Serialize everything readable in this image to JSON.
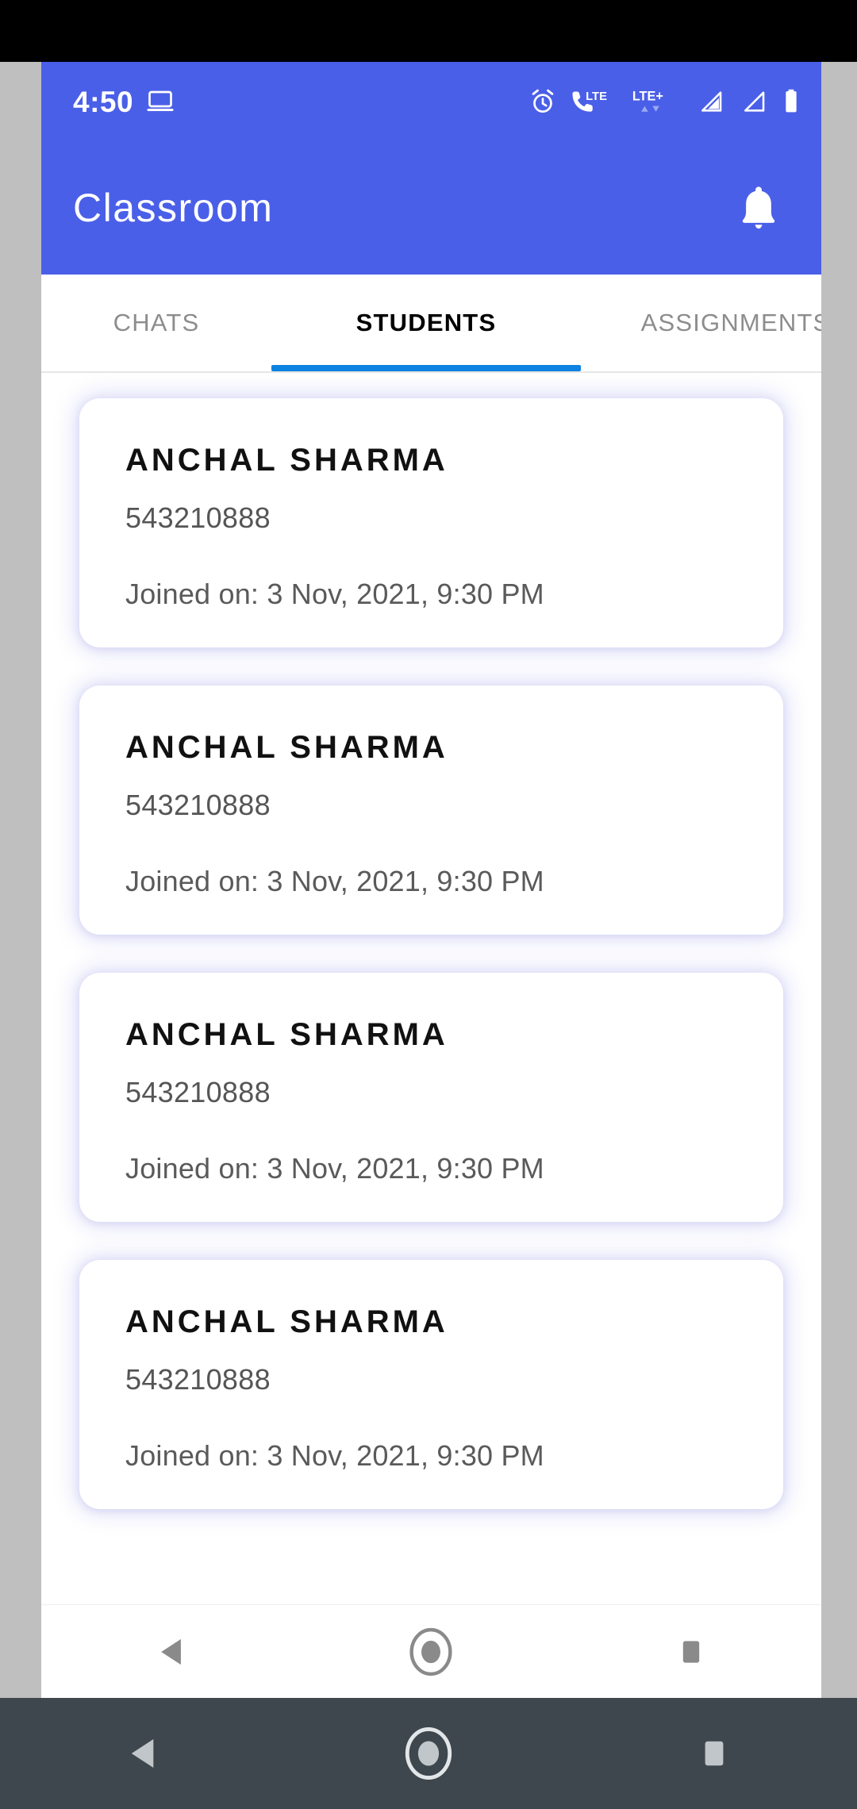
{
  "status_bar": {
    "time": "4:50",
    "icons": [
      "laptop-cast-icon",
      "alarm-clock-icon",
      "phone-lte-icon",
      "lte-plus-icon",
      "signal-bar-1-icon",
      "signal-bar-2-icon",
      "battery-full-icon"
    ],
    "lte_label": "LTE",
    "lte_plus_label": "LTE+",
    "background_color": "#4a5fe8"
  },
  "app_bar": {
    "title": "Classroom",
    "notification_icon": "bell-icon",
    "background_color": "#4a5fe8",
    "text_color": "#ffffff"
  },
  "tabs": {
    "active_index": 1,
    "indicator_color": "#0d82e0",
    "items": [
      {
        "label": "CHATS"
      },
      {
        "label": "STUDENTS"
      },
      {
        "label": "ASSIGNMENTS"
      }
    ]
  },
  "students": [
    {
      "name": "ANCHAL SHARMA",
      "id": "543210888",
      "joined": "Joined on: 3 Nov, 2021, 9:30 PM"
    },
    {
      "name": "ANCHAL SHARMA",
      "id": "543210888",
      "joined": "Joined on: 3 Nov, 2021, 9:30 PM"
    },
    {
      "name": "ANCHAL SHARMA",
      "id": "543210888",
      "joined": "Joined on: 3 Nov, 2021, 9:30 PM"
    },
    {
      "name": "ANCHAL SHARMA",
      "id": "543210888",
      "joined": "Joined on: 3 Nov, 2021, 9:30 PM"
    }
  ],
  "navigation_bar": {
    "back_icon": "back-triangle-icon",
    "home_icon": "home-circle-icon",
    "recents_icon": "recents-square-icon",
    "inner_background": "#ffffff",
    "system_background": "#3e474d"
  }
}
